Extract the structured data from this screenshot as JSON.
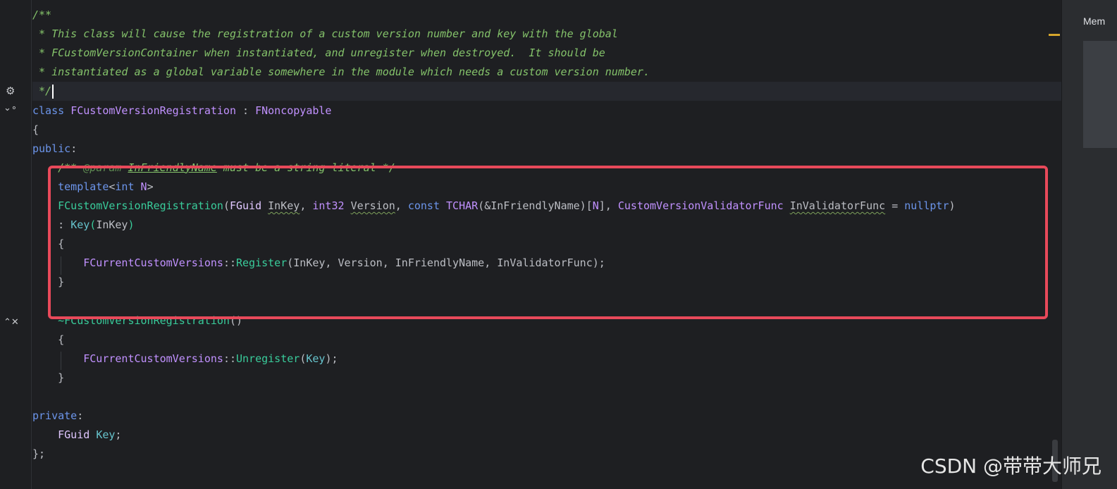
{
  "editor": {
    "lines": [
      {
        "row": 0,
        "tokens": [
          [
            "t-doc",
            "/**"
          ]
        ]
      },
      {
        "row": 1,
        "tokens": [
          [
            "t-doc",
            " * This class will cause the registration of a custom version number and key with the global"
          ]
        ]
      },
      {
        "row": 2,
        "tokens": [
          [
            "t-doc",
            " * FCustomVersionContainer when instantiated, and unregister when destroyed.  It should be"
          ]
        ]
      },
      {
        "row": 3,
        "tokens": [
          [
            "t-doc",
            " * instantiated as a global variable somewhere in the module which needs a custom version number."
          ]
        ]
      },
      {
        "row": 4,
        "current": true,
        "caret": true,
        "tokens": [
          [
            "t-doc",
            " */"
          ]
        ]
      },
      {
        "row": 5,
        "tokens": [
          [
            "t-kw",
            "class "
          ],
          [
            "t-cls",
            "FCustomVersionRegistration"
          ],
          [
            "t-pn",
            " : "
          ],
          [
            "t-cls",
            "FNoncopyable"
          ]
        ]
      },
      {
        "row": 6,
        "tokens": [
          [
            "t-pn",
            "{"
          ]
        ]
      },
      {
        "row": 7,
        "tokens": [
          [
            "t-kw",
            "public"
          ],
          [
            "t-pn",
            ":"
          ]
        ]
      },
      {
        "row": 8,
        "tokens": [
          [
            "t-pn",
            "    "
          ],
          [
            "t-cm",
            "/** "
          ],
          [
            "t-tag",
            "@param "
          ],
          [
            "t-cm ul",
            "InFriendlyName"
          ],
          [
            "t-cm",
            " must be a string literal */"
          ]
        ]
      },
      {
        "row": 9,
        "tokens": [
          [
            "t-pn",
            "    "
          ],
          [
            "t-kw",
            "template"
          ],
          [
            "t-pn",
            "<"
          ],
          [
            "t-kw",
            "int "
          ],
          [
            "t-cls",
            "N"
          ],
          [
            "t-pn",
            ">"
          ]
        ]
      },
      {
        "row": 10,
        "tokens": [
          [
            "t-pn",
            "    "
          ],
          [
            "t-fn",
            "FCustomVersionRegistration"
          ],
          [
            "t-pn",
            "("
          ],
          [
            "t-ty",
            "FGuid "
          ],
          [
            "t-pn sq",
            "InKey"
          ],
          [
            "t-pn",
            ", "
          ],
          [
            "t-cls",
            "int32 "
          ],
          [
            "t-pn sq",
            "Version"
          ],
          [
            "t-pn",
            ", "
          ],
          [
            "t-kw",
            "const "
          ],
          [
            "t-cls",
            "TCHAR"
          ],
          [
            "t-pn",
            "(&InFriendlyName)["
          ],
          [
            "t-cls",
            "N"
          ],
          [
            "t-pn",
            "], "
          ],
          [
            "t-cls",
            "CustomVersionValidatorFunc "
          ],
          [
            "t-pn sq",
            "InValidatorFunc"
          ],
          [
            "t-pn",
            " = "
          ],
          [
            "t-kw",
            "nullptr"
          ],
          [
            "t-pn",
            ")"
          ]
        ]
      },
      {
        "row": 11,
        "tokens": [
          [
            "t-pn",
            "    : "
          ],
          [
            "t-fld",
            "Key"
          ],
          [
            "t-fn",
            "("
          ],
          [
            "t-pn",
            "InKey"
          ],
          [
            "t-fn",
            ")"
          ]
        ]
      },
      {
        "row": 12,
        "tokens": [
          [
            "t-pn",
            "    {"
          ]
        ]
      },
      {
        "row": 13,
        "tokens": [
          [
            "t-pn",
            "        "
          ],
          [
            "t-cls",
            "FCurrentCustomVersions"
          ],
          [
            "t-pn",
            "::"
          ],
          [
            "t-fn",
            "Register"
          ],
          [
            "t-pn",
            "(InKey, Version, InFriendlyName, InValidatorFunc);"
          ]
        ]
      },
      {
        "row": 14,
        "tokens": [
          [
            "t-pn",
            "    }"
          ]
        ]
      },
      {
        "row": 15,
        "tokens": []
      },
      {
        "row": 16,
        "tokens": [
          [
            "t-pn",
            "    "
          ],
          [
            "t-fn",
            "~FCustomVersionRegistration"
          ],
          [
            "t-pn",
            "()"
          ]
        ]
      },
      {
        "row": 17,
        "tokens": [
          [
            "t-pn",
            "    {"
          ]
        ]
      },
      {
        "row": 18,
        "tokens": [
          [
            "t-pn",
            "        "
          ],
          [
            "t-cls",
            "FCurrentCustomVersions"
          ],
          [
            "t-pn",
            "::"
          ],
          [
            "t-fn",
            "Unregister"
          ],
          [
            "t-pn",
            "("
          ],
          [
            "t-fld",
            "Key"
          ],
          [
            "t-pn",
            ");"
          ]
        ]
      },
      {
        "row": 19,
        "tokens": [
          [
            "t-pn",
            "    }"
          ]
        ]
      },
      {
        "row": 20,
        "tokens": []
      },
      {
        "row": 21,
        "tokens": [
          [
            "t-kw",
            "private"
          ],
          [
            "t-pn",
            ":"
          ]
        ]
      },
      {
        "row": 22,
        "tokens": [
          [
            "t-pn",
            "    "
          ],
          [
            "t-ty",
            "FGuid "
          ],
          [
            "t-fld",
            "Key"
          ],
          [
            "t-pn",
            ";"
          ]
        ]
      },
      {
        "row": 23,
        "tokens": [
          [
            "t-pn",
            "};"
          ]
        ]
      }
    ]
  },
  "gutter": {
    "icon_bulb": "💡",
    "icon_fold1": "⌄",
    "icon_fold2": "⌃"
  },
  "right_panel": {
    "tab_label": "Mem"
  },
  "watermark": "CSDN @带带大师兄"
}
